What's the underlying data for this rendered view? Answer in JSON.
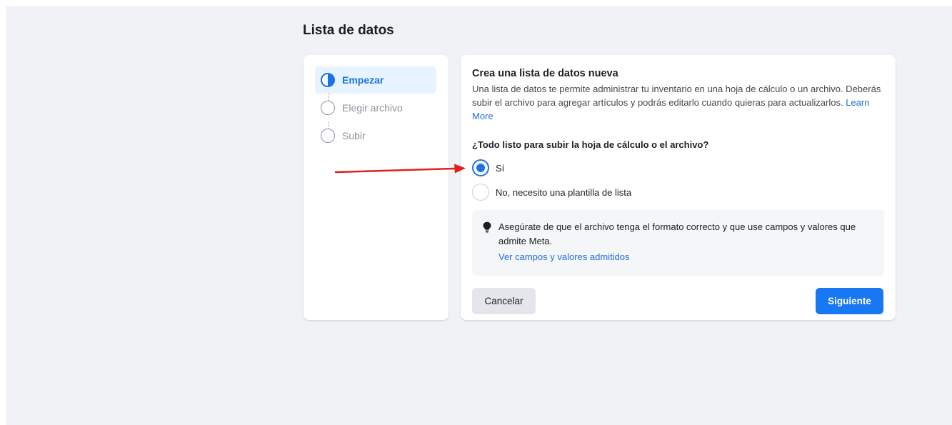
{
  "page": {
    "title": "Lista de datos"
  },
  "stepper": {
    "steps": [
      {
        "label": "Empezar",
        "state": "active"
      },
      {
        "label": "Elegir archivo",
        "state": "pending"
      },
      {
        "label": "Subir",
        "state": "pending"
      }
    ]
  },
  "card": {
    "title": "Crea una lista de datos nueva",
    "description": "Una lista de datos te permite administrar tu inventario en una hoja de cálculo o un archivo. Deberás subir el archivo para agregar artículos y podrás editarlo cuando quieras para actualizarlos.",
    "learn_more": "Learn More",
    "question": "¿Todo listo para subir la hoja de cálculo o el archivo?",
    "options": [
      {
        "label": "Sí",
        "checked": true
      },
      {
        "label": "No, necesito una plantilla de lista",
        "checked": false
      }
    ],
    "tip": {
      "text": "Asegúrate de que el archivo tenga el formato correcto y que use campos y valores que admite Meta.",
      "link": "Ver campos y valores admitidos"
    },
    "cancel_label": "Cancelar",
    "next_label": "Siguiente"
  },
  "colors": {
    "accent": "#1877f2",
    "annotation_arrow": "#e0201b",
    "background": "#f0f2f5"
  },
  "icons": {
    "step_active": "half-filled-circle-icon",
    "step_pending": "empty-circle-icon",
    "tip": "lightbulb-icon",
    "annotation": "red-arrow-icon"
  }
}
